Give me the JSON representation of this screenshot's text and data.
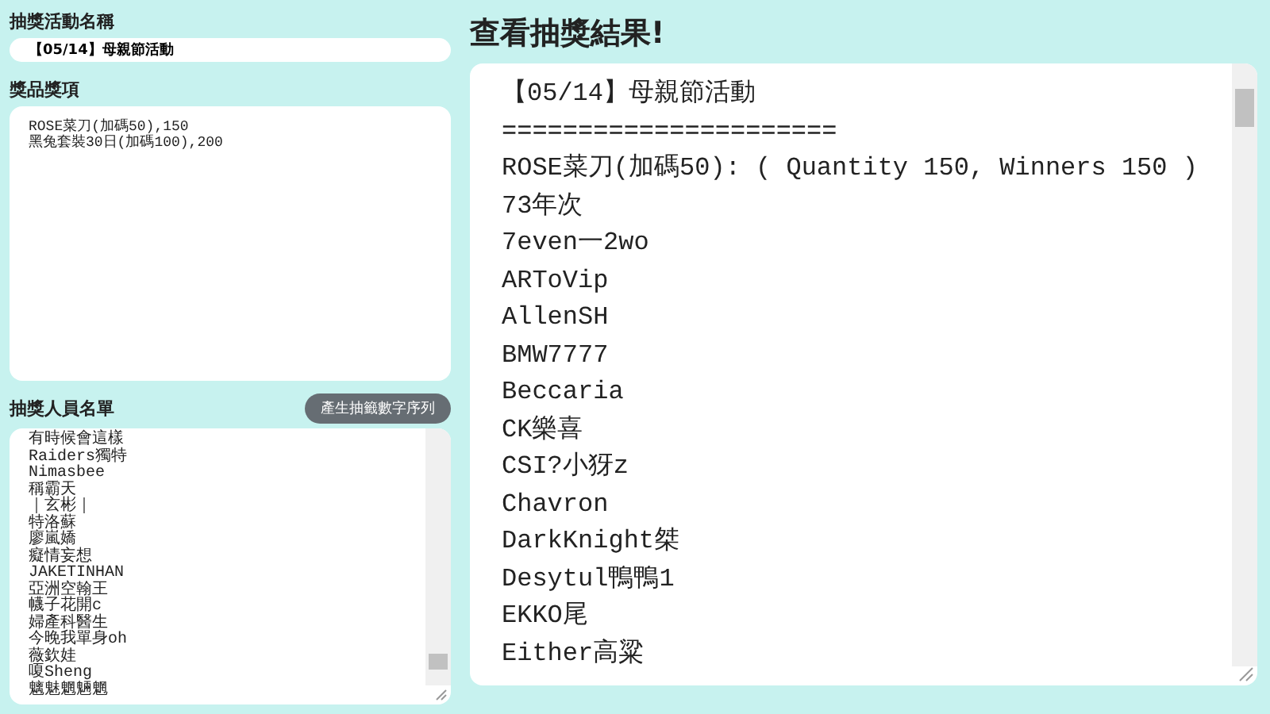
{
  "event_name": {
    "label": "抽獎活動名稱",
    "value": "【05/14】母親節活動"
  },
  "prizes": {
    "label": "獎品獎項",
    "lines": [
      "ROSE菜刀(加碼50),150",
      "黑兔套裝30日(加碼100),200"
    ]
  },
  "participants": {
    "label": "抽獎人員名單",
    "button": "產生抽籤數字序列",
    "lines": [
      "有時候會這樣",
      "Raiders獨特",
      "Nimasbee",
      "稱霸天",
      "｜玄彬｜",
      "特洛蘇",
      "廖嵐嬌",
      "癡情妄想",
      "JAKETINHAN",
      "亞洲空翰王",
      "幭子花開c",
      "婦產科醫生",
      "今晚我單身oh",
      "薇欽娃",
      "嗄Sheng",
      "魑魅魍魎魍"
    ]
  },
  "results": {
    "title": "查看抽獎結果!",
    "lines": [
      "【05/14】母親節活動",
      "======================",
      "ROSE菜刀(加碼50): ( Quantity 150, Winners 150 )",
      "73年次",
      "7even一2wo",
      "ARToVip",
      "AllenSH",
      "BMW7777",
      "Beccaria",
      "CK樂喜",
      "CSI?小犽z",
      "Chavron",
      "DarkKnight桀",
      "Desytul鴨鴨1",
      "EKKO尾",
      "Either高粱"
    ]
  }
}
